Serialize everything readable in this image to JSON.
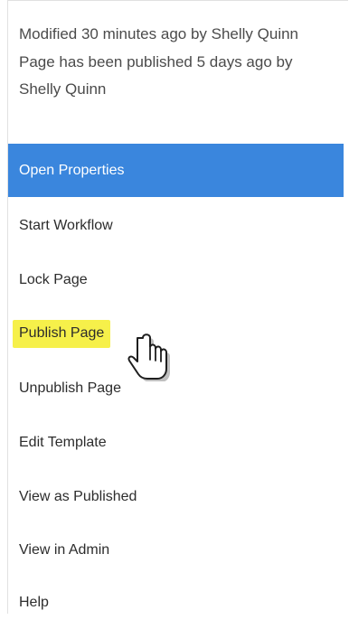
{
  "meta": {
    "modified_line": "Modified 30 minutes ago by Shelly Quinn",
    "published_line": "Page has been published 5 days ago by Shelly Quinn"
  },
  "menu": {
    "items": [
      {
        "label": "Open Properties",
        "active": true
      },
      {
        "label": "Start Workflow"
      },
      {
        "label": "Lock Page"
      },
      {
        "label": "Publish Page",
        "highlighted": true
      },
      {
        "label": "Unpublish Page"
      },
      {
        "label": "Edit Template"
      },
      {
        "label": "View as Published"
      },
      {
        "label": "View in Admin"
      },
      {
        "label": "Help"
      }
    ]
  },
  "colors": {
    "active_bg": "#3a86dd",
    "highlight_bg": "#f6f04a",
    "text": "#2c2c2c"
  },
  "cursor": {
    "icon": "hand-pointer-icon"
  }
}
